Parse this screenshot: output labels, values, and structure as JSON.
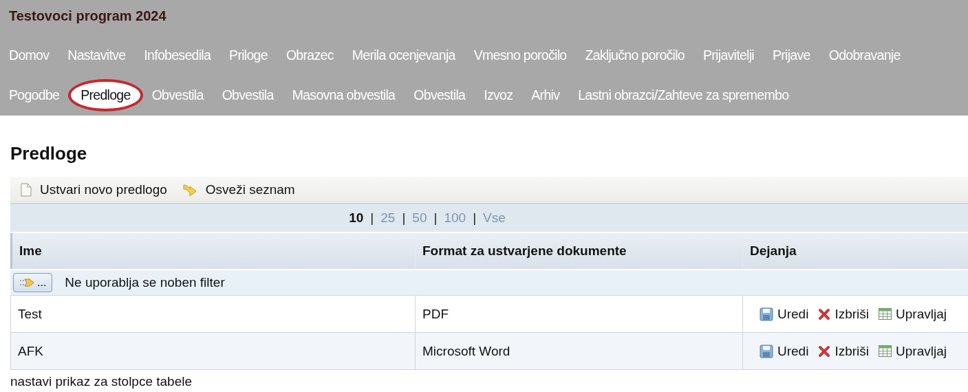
{
  "app": {
    "title": "Testovoci program 2024"
  },
  "nav": [
    [
      {
        "label": "Domov",
        "selected": false
      },
      {
        "label": "Nastavitve",
        "selected": false
      },
      {
        "label": "Infobesedila",
        "selected": false
      },
      {
        "label": "Priloge",
        "selected": false
      },
      {
        "label": "Obrazec",
        "selected": false
      },
      {
        "label": "Merila ocenjevanja",
        "selected": false
      },
      {
        "label": "Vmesno poročilo",
        "selected": false
      },
      {
        "label": "Zaključno poročilo",
        "selected": false
      },
      {
        "label": "Prijavitelji",
        "selected": false
      },
      {
        "label": "Prijave",
        "selected": false
      },
      {
        "label": "Odobravanje",
        "selected": false
      }
    ],
    [
      {
        "label": "Pogodbe",
        "selected": false
      },
      {
        "label": "Predloge",
        "selected": true
      },
      {
        "label": "Obvestila",
        "selected": false
      },
      {
        "label": "Obvestila",
        "selected": false
      },
      {
        "label": "Masovna obvestila",
        "selected": false
      },
      {
        "label": "Obvestila",
        "selected": false
      },
      {
        "label": "Izvoz",
        "selected": false
      },
      {
        "label": "Arhiv",
        "selected": false
      },
      {
        "label": "Lastni obrazci/Zahteve za spremembo",
        "selected": false
      }
    ]
  ],
  "page": {
    "heading": "Predloge"
  },
  "toolbar": [
    {
      "label": "Ustvari novo predlogo",
      "kind": "new"
    },
    {
      "label": "Osveži seznam",
      "kind": "refresh"
    }
  ],
  "pager": {
    "sizes": [
      {
        "label": "10",
        "selected": true
      },
      {
        "label": "25",
        "selected": false
      },
      {
        "label": "50",
        "selected": false
      },
      {
        "label": "100",
        "selected": false
      },
      {
        "label": "Vse",
        "selected": false
      }
    ],
    "separator": "|"
  },
  "table": {
    "columns": [
      "Ime",
      "Format za ustvarjene dokumente",
      "Dejanja"
    ],
    "filter": {
      "button": "...",
      "text": "Ne uporablja se noben filter"
    },
    "rows": [
      {
        "cells": [
          "Test",
          "PDF"
        ],
        "actions": [
          {
            "label": "Uredi",
            "kind": "edit"
          },
          {
            "label": "Izbriši",
            "kind": "delete"
          },
          {
            "label": "Upravljaj",
            "kind": "manage"
          }
        ]
      },
      {
        "cells": [
          "AFK",
          "Microsoft Word"
        ],
        "actions": [
          {
            "label": "Uredi",
            "kind": "edit"
          },
          {
            "label": "Izbriši",
            "kind": "delete"
          },
          {
            "label": "Upravljaj",
            "kind": "manage"
          }
        ]
      }
    ]
  },
  "footer_link": "nastavi prikaz za stolpce tabele"
}
